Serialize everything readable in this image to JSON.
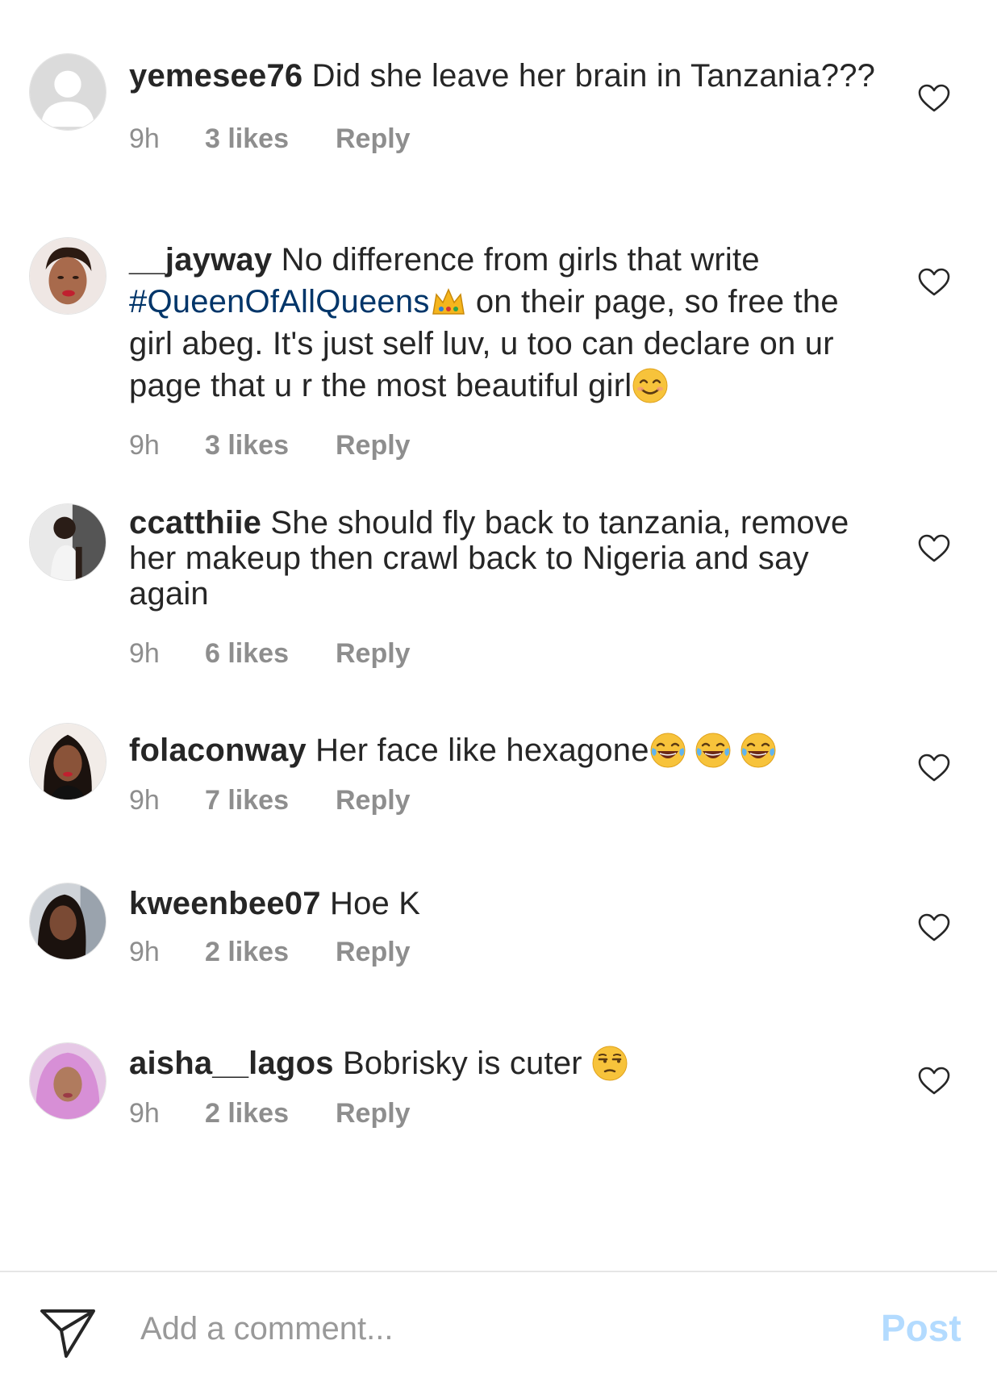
{
  "comments": [
    {
      "username": "yemesee76",
      "text": " Did she leave her brain in Tanzania???",
      "time": "9h",
      "likes": "3 likes",
      "reply": "Reply"
    },
    {
      "username": "__jayway",
      "text_before": " No difference from girls that write ",
      "hashtag": "#QueenOfAllQueens",
      "emoji_1": "crown-emoji",
      "text_after": " on their page, so free the girl abeg. It's just self luv, u too can declare on ur page that u r the most beautiful girl",
      "emoji_2": "smiling-face-emoji",
      "time": "9h",
      "likes": "3 likes",
      "reply": "Reply"
    },
    {
      "username": "ccatthiie",
      "text": " She should fly back to tanzania, remove her makeup then crawl back to Nigeria and say again",
      "time": "9h",
      "likes": "6 likes",
      "reply": "Reply"
    },
    {
      "username": "folaconway",
      "text": " Her face like hexagone",
      "emoji": "tears-of-joy-emoji",
      "time": "9h",
      "likes": "7 likes",
      "reply": "Reply"
    },
    {
      "username": "kweenbee07",
      "text": " Hoe K",
      "time": "9h",
      "likes": "2 likes",
      "reply": "Reply"
    },
    {
      "username": "aisha__lagos",
      "text": " Bobrisky is cuter ",
      "emoji": "unamused-face-emoji",
      "time": "9h",
      "likes": "2 likes",
      "reply": "Reply"
    }
  ],
  "composer": {
    "placeholder": "Add a comment...",
    "post_label": "Post",
    "share_icon": "paper-plane-icon"
  },
  "colors": {
    "username": "#262626",
    "meta": "#8e8e8e",
    "hashtag": "#003569",
    "post_disabled": "#b3dbff"
  }
}
